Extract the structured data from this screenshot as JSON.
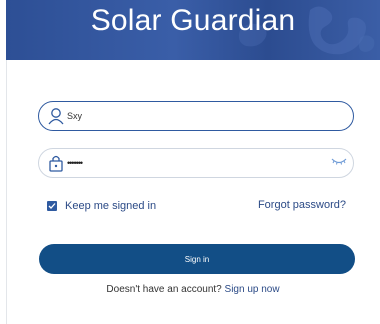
{
  "banner": {
    "title": "Solar Guardian"
  },
  "login": {
    "username": {
      "value": "Sxy",
      "icon": "user-icon"
    },
    "password": {
      "value": "•••••••",
      "icon": "lock-icon",
      "toggle_icon": "eye-closed-icon"
    },
    "remember_label": "Keep me signed in",
    "remember_checked": true,
    "forgot_label": "Forgot password?",
    "signin_label": "Sign in",
    "no_account_text": "Doesn't have an account?",
    "signup_label": "Sign up now"
  },
  "colors": {
    "banner": "#3a5ea8",
    "accent": "#2f5aa0",
    "button": "#124e86",
    "link": "#2b4a86"
  }
}
